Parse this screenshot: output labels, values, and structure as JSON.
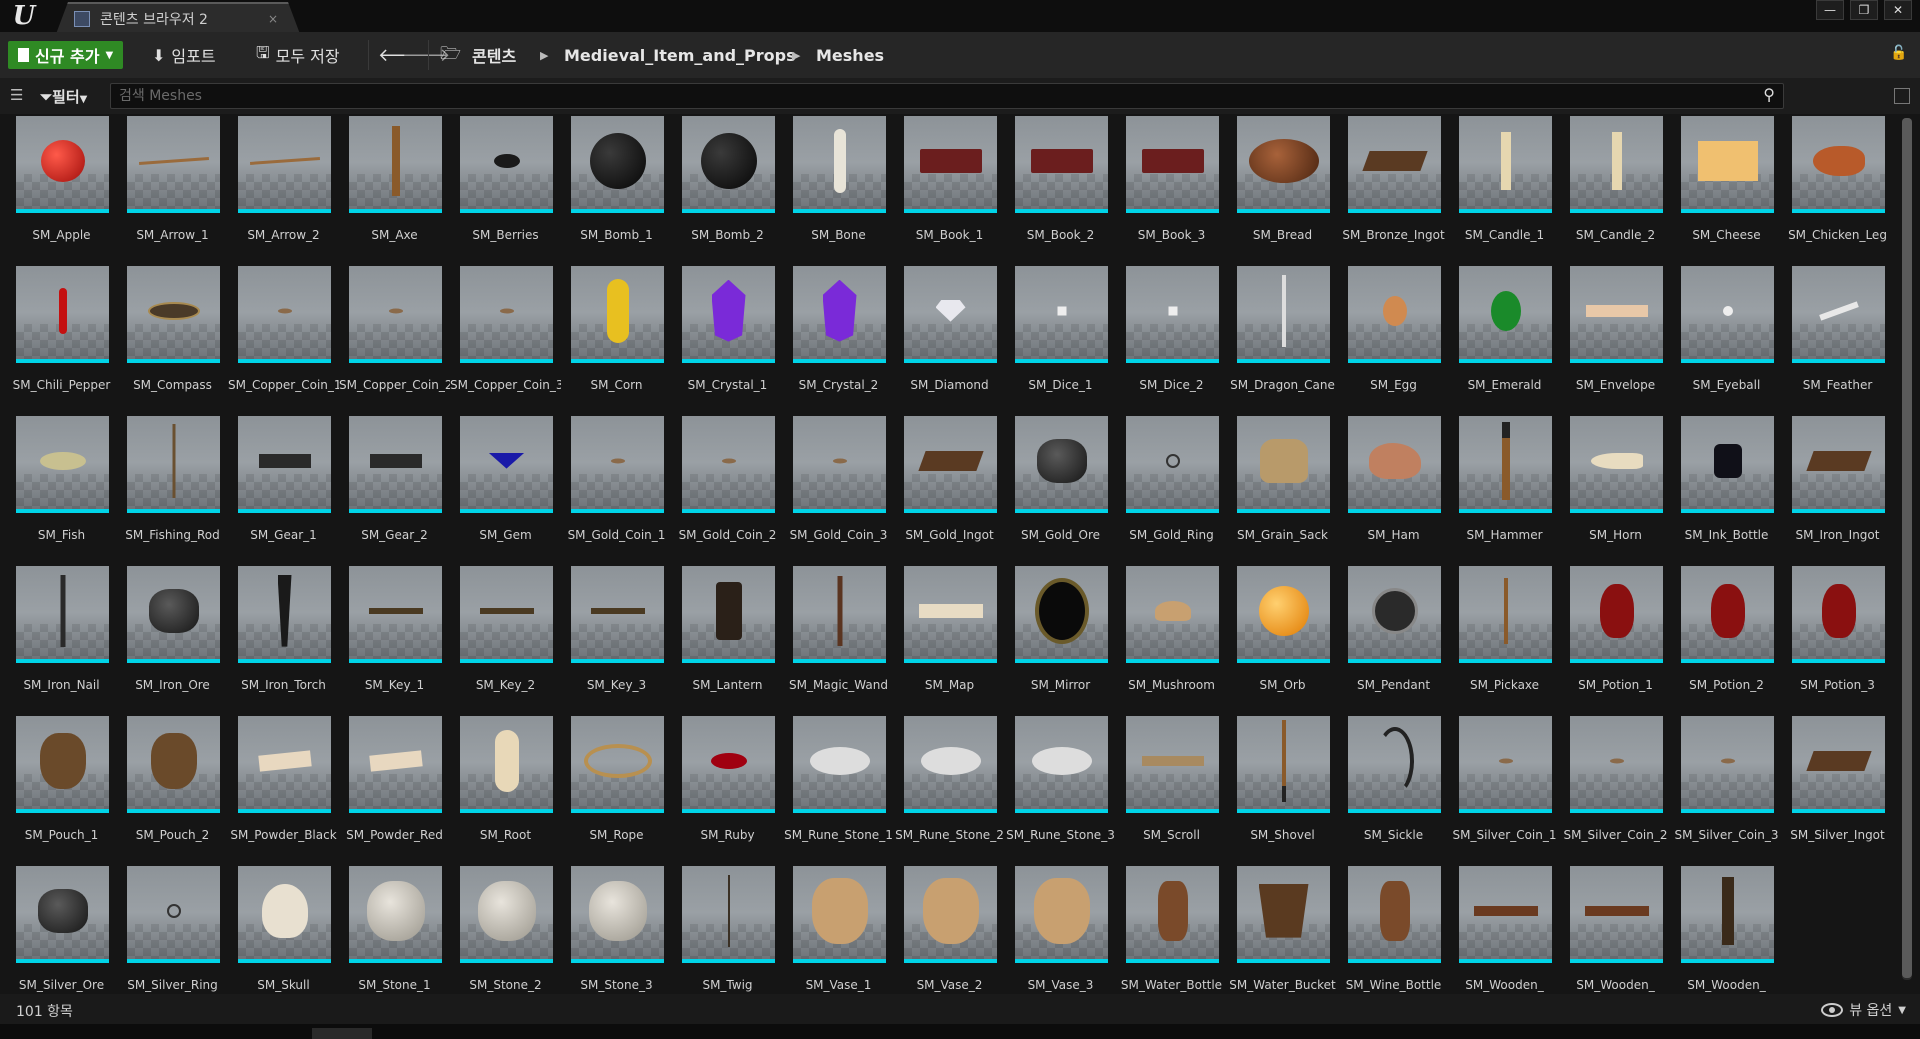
{
  "titlebar": {
    "tab_title": "콘텐츠 브라우저 2",
    "tab_close": "×",
    "minimize": "—",
    "restore": "❐",
    "close": "✕"
  },
  "toolbar": {
    "add_new": "신규 추가",
    "import": "임포트",
    "save_all": "모두 저장",
    "path": [
      "콘텐츠",
      "Medieval_Item_and_Props",
      "Meshes"
    ]
  },
  "search": {
    "filter_label": "필터",
    "placeholder": "검색 Meshes"
  },
  "status": {
    "item_count": "101 항목",
    "view_options": "뷰 옵션"
  },
  "colors": {
    "add_button": "#2f8a24",
    "thumbnail_underline": "#00d4e8",
    "background": "#151515"
  },
  "assets": [
    {
      "name": "SM_Apple",
      "icon": "apple"
    },
    {
      "name": "SM_Arrow_1",
      "icon": "arrow"
    },
    {
      "name": "SM_Arrow_2",
      "icon": "arrow"
    },
    {
      "name": "SM_Axe",
      "icon": "axe"
    },
    {
      "name": "SM_Berries",
      "icon": "berries"
    },
    {
      "name": "SM_Bomb_1",
      "icon": "bomb"
    },
    {
      "name": "SM_Bomb_2",
      "icon": "bomb"
    },
    {
      "name": "SM_Bone",
      "icon": "bone"
    },
    {
      "name": "SM_Book_1",
      "icon": "book"
    },
    {
      "name": "SM_Book_2",
      "icon": "book"
    },
    {
      "name": "SM_Book_3",
      "icon": "book"
    },
    {
      "name": "SM_Bread",
      "icon": "bread"
    },
    {
      "name": "SM_Bronze_Ingot",
      "icon": "ingot"
    },
    {
      "name": "SM_Candle_1",
      "icon": "candle"
    },
    {
      "name": "SM_Candle_2",
      "icon": "candle"
    },
    {
      "name": "SM_Cheese",
      "icon": "cheese"
    },
    {
      "name": "SM_Chicken_Leg",
      "icon": "chicken-leg"
    },
    {
      "name": "SM_Chili_Pepper",
      "icon": "pepper"
    },
    {
      "name": "SM_Compass",
      "icon": "compass"
    },
    {
      "name": "SM_Copper_Coin_1",
      "icon": "coin"
    },
    {
      "name": "SM_Copper_Coin_2",
      "icon": "coin"
    },
    {
      "name": "SM_Copper_Coin_3",
      "icon": "coin"
    },
    {
      "name": "SM_Corn",
      "icon": "corn"
    },
    {
      "name": "SM_Crystal_1",
      "icon": "crystal"
    },
    {
      "name": "SM_Crystal_2",
      "icon": "crystal"
    },
    {
      "name": "SM_Diamond",
      "icon": "diamond"
    },
    {
      "name": "SM_Dice_1",
      "icon": "dice"
    },
    {
      "name": "SM_Dice_2",
      "icon": "dice"
    },
    {
      "name": "SM_Dragon_Cane",
      "icon": "cane"
    },
    {
      "name": "SM_Egg",
      "icon": "egg"
    },
    {
      "name": "SM_Emerald",
      "icon": "emerald"
    },
    {
      "name": "SM_Envelope",
      "icon": "envelope"
    },
    {
      "name": "SM_Eyeball",
      "icon": "eyeball"
    },
    {
      "name": "SM_Feather",
      "icon": "feather"
    },
    {
      "name": "SM_Fish",
      "icon": "fish"
    },
    {
      "name": "SM_Fishing_Rod",
      "icon": "fishing-rod"
    },
    {
      "name": "SM_Gear_1",
      "icon": "gear"
    },
    {
      "name": "SM_Gear_2",
      "icon": "gear"
    },
    {
      "name": "SM_Gem",
      "icon": "gem"
    },
    {
      "name": "SM_Gold_Coin_1",
      "icon": "coin"
    },
    {
      "name": "SM_Gold_Coin_2",
      "icon": "coin"
    },
    {
      "name": "SM_Gold_Coin_3",
      "icon": "coin"
    },
    {
      "name": "SM_Gold_Ingot",
      "icon": "ingot"
    },
    {
      "name": "SM_Gold_Ore",
      "icon": "ore"
    },
    {
      "name": "SM_Gold_Ring",
      "icon": "ring"
    },
    {
      "name": "SM_Grain_Sack",
      "icon": "sack"
    },
    {
      "name": "SM_Ham",
      "icon": "ham"
    },
    {
      "name": "SM_Hammer",
      "icon": "hammer"
    },
    {
      "name": "SM_Horn",
      "icon": "horn"
    },
    {
      "name": "SM_Ink_Bottle",
      "icon": "ink-bottle"
    },
    {
      "name": "SM_Iron_Ingot",
      "icon": "ingot"
    },
    {
      "name": "SM_Iron_Nail",
      "icon": "nail"
    },
    {
      "name": "SM_Iron_Ore",
      "icon": "ore"
    },
    {
      "name": "SM_Iron_Torch",
      "icon": "torch"
    },
    {
      "name": "SM_Key_1",
      "icon": "key"
    },
    {
      "name": "SM_Key_2",
      "icon": "key"
    },
    {
      "name": "SM_Key_3",
      "icon": "key"
    },
    {
      "name": "SM_Lantern",
      "icon": "lantern"
    },
    {
      "name": "SM_Magic_Wand",
      "icon": "wand"
    },
    {
      "name": "SM_Map",
      "icon": "map"
    },
    {
      "name": "SM_Mirror",
      "icon": "mirror"
    },
    {
      "name": "SM_Mushroom",
      "icon": "mushroom"
    },
    {
      "name": "SM_Orb",
      "icon": "orb"
    },
    {
      "name": "SM_Pendant",
      "icon": "pendant"
    },
    {
      "name": "SM_Pickaxe",
      "icon": "pickaxe"
    },
    {
      "name": "SM_Potion_1",
      "icon": "potion"
    },
    {
      "name": "SM_Potion_2",
      "icon": "potion"
    },
    {
      "name": "SM_Potion_3",
      "icon": "potion"
    },
    {
      "name": "SM_Pouch_1",
      "icon": "pouch"
    },
    {
      "name": "SM_Pouch_2",
      "icon": "pouch"
    },
    {
      "name": "SM_Powder_Black",
      "icon": "powder"
    },
    {
      "name": "SM_Powder_Red",
      "icon": "powder"
    },
    {
      "name": "SM_Root",
      "icon": "root"
    },
    {
      "name": "SM_Rope",
      "icon": "rope"
    },
    {
      "name": "SM_Ruby",
      "icon": "ruby"
    },
    {
      "name": "SM_Rune_Stone_1",
      "icon": "rune-stone"
    },
    {
      "name": "SM_Rune_Stone_2",
      "icon": "rune-stone"
    },
    {
      "name": "SM_Rune_Stone_3",
      "icon": "rune-stone"
    },
    {
      "name": "SM_Scroll",
      "icon": "scroll"
    },
    {
      "name": "SM_Shovel",
      "icon": "shovel"
    },
    {
      "name": "SM_Sickle",
      "icon": "sickle"
    },
    {
      "name": "SM_Silver_Coin_1",
      "icon": "coin"
    },
    {
      "name": "SM_Silver_Coin_2",
      "icon": "coin"
    },
    {
      "name": "SM_Silver_Coin_3",
      "icon": "coin"
    },
    {
      "name": "SM_Silver_Ingot",
      "icon": "ingot"
    },
    {
      "name": "SM_Silver_Ore",
      "icon": "ore"
    },
    {
      "name": "SM_Silver_Ring",
      "icon": "ring"
    },
    {
      "name": "SM_Skull",
      "icon": "skull"
    },
    {
      "name": "SM_Stone_1",
      "icon": "stone"
    },
    {
      "name": "SM_Stone_2",
      "icon": "stone"
    },
    {
      "name": "SM_Stone_3",
      "icon": "stone"
    },
    {
      "name": "SM_Twig",
      "icon": "twig"
    },
    {
      "name": "SM_Vase_1",
      "icon": "vase"
    },
    {
      "name": "SM_Vase_2",
      "icon": "vase"
    },
    {
      "name": "SM_Vase_3",
      "icon": "vase"
    },
    {
      "name": "SM_Water_Bottle",
      "icon": "bottle"
    },
    {
      "name": "SM_Water_Bucket",
      "icon": "bucket"
    },
    {
      "name": "SM_Wine_Bottle",
      "icon": "bottle"
    },
    {
      "name": "SM_Wooden_",
      "icon": "plank"
    },
    {
      "name": "SM_Wooden_",
      "icon": "plank"
    },
    {
      "name": "SM_Wooden_",
      "icon": "post"
    }
  ]
}
